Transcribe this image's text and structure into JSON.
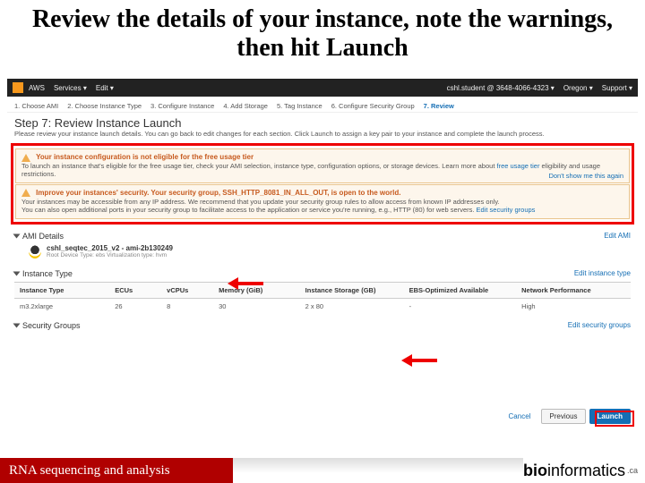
{
  "slide_title": "Review the details of your instance, note the warnings, then hit Launch",
  "topbar": {
    "aws": "AWS",
    "services": "Services ▾",
    "edit": "Edit ▾",
    "user": "cshl.student @ 3648-4066-4323 ▾",
    "region": "Oregon ▾",
    "support": "Support ▾"
  },
  "wizard": {
    "s1": "1. Choose AMI",
    "s2": "2. Choose Instance Type",
    "s3": "3. Configure Instance",
    "s4": "4. Add Storage",
    "s5": "5. Tag Instance",
    "s6": "6. Configure Security Group",
    "s7": "7. Review"
  },
  "step7": {
    "title": "Step 7: Review Instance Launch",
    "desc": "Please review your instance launch details. You can go back to edit changes for each section. Click Launch to assign a key pair to your instance and complete the launch process."
  },
  "warn1": {
    "title": "Your instance configuration is not eligible for the free usage tier",
    "body": "To launch an instance that's eligible for the free usage tier, check your AMI selection, instance type, configuration options, or storage devices. Learn more about",
    "link1": "free usage tier",
    "tail": "eligibility and usage restrictions.",
    "dont": "Don't show me this again"
  },
  "warn2": {
    "title": "Improve your instances' security. Your security group, SSH_HTTP_8081_IN_ALL_OUT, is open to the world.",
    "l1": "Your instances may be accessible from any IP address. We recommend that you update your security group rules to allow access from known IP addresses only.",
    "l2": "You can also open additional ports in your security group to facilitate access to the application or service you're running, e.g., HTTP (80) for web servers.",
    "link": "Edit security groups"
  },
  "ami": {
    "header": "AMI Details",
    "edit": "Edit AMI",
    "name": "cshl_seqtec_2015_v2 - ami-2b130249",
    "sub": "Root Device Type: ebs    Virtualization type: hvm"
  },
  "itype": {
    "header": "Instance Type",
    "edit": "Edit instance type",
    "cols": {
      "c1": "Instance Type",
      "c2": "ECUs",
      "c3": "vCPUs",
      "c4": "Memory (GiB)",
      "c5": "Instance Storage (GB)",
      "c6": "EBS-Optimized Available",
      "c7": "Network Performance"
    },
    "row": {
      "c1": "m3.2xlarge",
      "c2": "26",
      "c3": "8",
      "c4": "30",
      "c5": "2 x 80",
      "c6": "-",
      "c7": "High"
    }
  },
  "sg": {
    "header": "Security Groups",
    "edit": "Edit security groups"
  },
  "buttons": {
    "cancel": "Cancel",
    "prev": "Previous",
    "launch": "Launch"
  },
  "footer": {
    "left": "RNA sequencing and analysis",
    "b1": "bio",
    "b2": "informatics",
    "dom": ".ca"
  }
}
